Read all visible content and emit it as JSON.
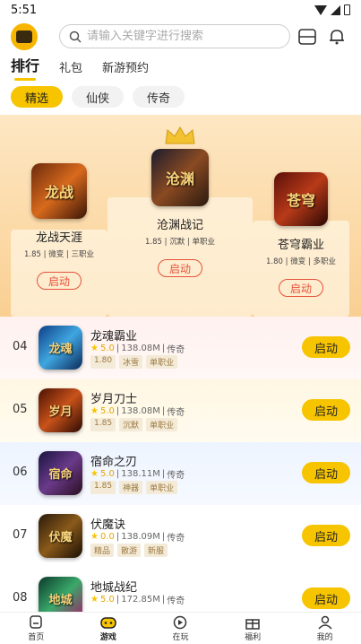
{
  "status_bar": {
    "time": "5:51"
  },
  "search": {
    "placeholder": "请输入关键字进行搜索"
  },
  "tabs": [
    {
      "label": "排行",
      "active": true
    },
    {
      "label": "礼包",
      "active": false
    },
    {
      "label": "新游预约",
      "active": false
    }
  ],
  "chips": [
    {
      "label": "精选",
      "active": true
    },
    {
      "label": "仙侠",
      "active": false
    },
    {
      "label": "传奇",
      "active": false
    }
  ],
  "podium": [
    {
      "rank": 2,
      "name": "龙战天涯",
      "meta": "1.85 | 微变 | 三职业",
      "button": "启动",
      "icon_text": "龙战"
    },
    {
      "rank": 1,
      "name": "沧渊战记",
      "meta": "1.85 | 沉默 | 单职业",
      "button": "启动",
      "icon_text": "沧渊"
    },
    {
      "rank": 3,
      "name": "苍穹霸业",
      "meta": "1.80 | 微变 | 多职业",
      "button": "启动",
      "icon_text": "苍穹"
    }
  ],
  "list": [
    {
      "rank": "04",
      "name": "龙魂霸业",
      "score": "5.0",
      "size": "138.08M",
      "genre": "传奇",
      "tags": [
        "1.80",
        "冰雪",
        "单职业"
      ],
      "button": "启动",
      "icon_text": "龙魂",
      "bg": "#fff3f1"
    },
    {
      "rank": "05",
      "name": "岁月刀士",
      "score": "5.0",
      "size": "138.08M",
      "genre": "传奇",
      "tags": [
        "1.85",
        "沉默",
        "单职业"
      ],
      "button": "启动",
      "icon_text": "岁月",
      "bg": "#fff8e6"
    },
    {
      "rank": "06",
      "name": "宿命之刃",
      "score": "5.0",
      "size": "138.11M",
      "genre": "传奇",
      "tags": [
        "1.85",
        "神器",
        "单职业"
      ],
      "button": "启动",
      "icon_text": "宿命",
      "bg": "#f1f6ff"
    },
    {
      "rank": "07",
      "name": "伏魔诀",
      "score": "0.0",
      "size": "138.09M",
      "genre": "传奇",
      "tags": [
        "精品",
        "散游",
        "新服"
      ],
      "button": "启动",
      "icon_text": "伏魔",
      "bg": "#ffffff"
    },
    {
      "rank": "08",
      "name": "地城战纪",
      "score": "5.0",
      "size": "172.85M",
      "genre": "传奇",
      "tags": [],
      "button": "启动",
      "icon_text": "地城",
      "bg": "#ffffff"
    }
  ],
  "bottom_nav": [
    {
      "label": "首页",
      "icon": "home-icon",
      "active": false
    },
    {
      "label": "游戏",
      "icon": "gamepad-icon",
      "active": true
    },
    {
      "label": "在玩",
      "icon": "play-icon",
      "active": false
    },
    {
      "label": "福利",
      "icon": "gift-icon",
      "active": false
    },
    {
      "label": "我的",
      "icon": "profile-icon",
      "active": false
    }
  ],
  "colors": {
    "accent": "#f7c400",
    "podium_button": "#e5533b"
  }
}
